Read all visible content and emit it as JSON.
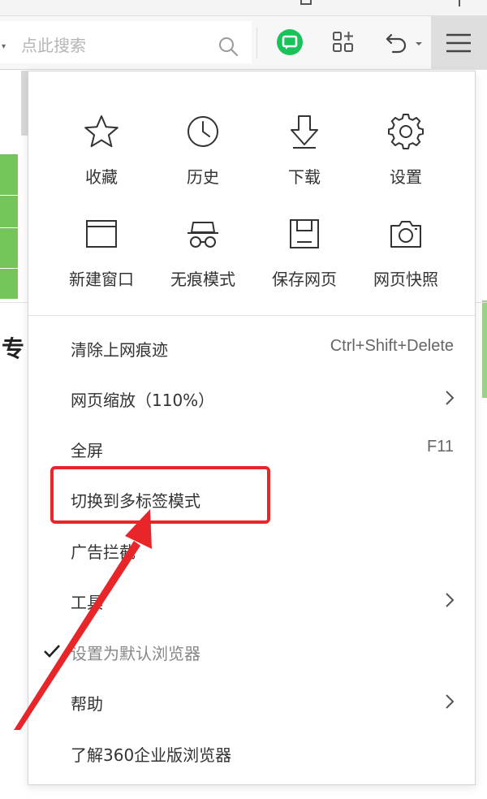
{
  "toolbar": {
    "search_placeholder": "点此搜索",
    "search_icon": "search-icon",
    "chat_icon": "chat-bubble-icon",
    "apps_icon": "apps-grid-icon",
    "undo_icon": "undo-icon",
    "menu_icon": "hamburger-menu-icon"
  },
  "page": {
    "visible_char": "专"
  },
  "menu": {
    "grid": [
      {
        "label": "收藏",
        "icon": "star-icon"
      },
      {
        "label": "历史",
        "icon": "clock-icon"
      },
      {
        "label": "下载",
        "icon": "download-icon"
      },
      {
        "label": "设置",
        "icon": "gear-icon"
      },
      {
        "label": "新建窗口",
        "icon": "new-window-icon"
      },
      {
        "label": "无痕模式",
        "icon": "incognito-icon"
      },
      {
        "label": "保存网页",
        "icon": "save-icon"
      },
      {
        "label": "网页快照",
        "icon": "camera-icon"
      }
    ],
    "items": [
      {
        "label": "清除上网痕迹",
        "shortcut": "Ctrl+Shift+Delete"
      },
      {
        "label": "网页缩放（110%）",
        "has_submenu": true
      },
      {
        "label": "全屏",
        "shortcut": "F11"
      },
      {
        "label": "切换到多标签模式"
      },
      {
        "label": "广告拦截"
      },
      {
        "label": "工具",
        "has_submenu": true
      },
      {
        "label": "设置为默认浏览器",
        "checked": true,
        "disabled": true
      },
      {
        "label": "帮助",
        "has_submenu": true
      },
      {
        "label": "了解360企业版浏览器"
      }
    ]
  },
  "colors": {
    "annotation_red": "#e8262a",
    "menu_button_bg": "#dedede",
    "chat_green": "#19c35a",
    "page_green": "#75c45a"
  }
}
